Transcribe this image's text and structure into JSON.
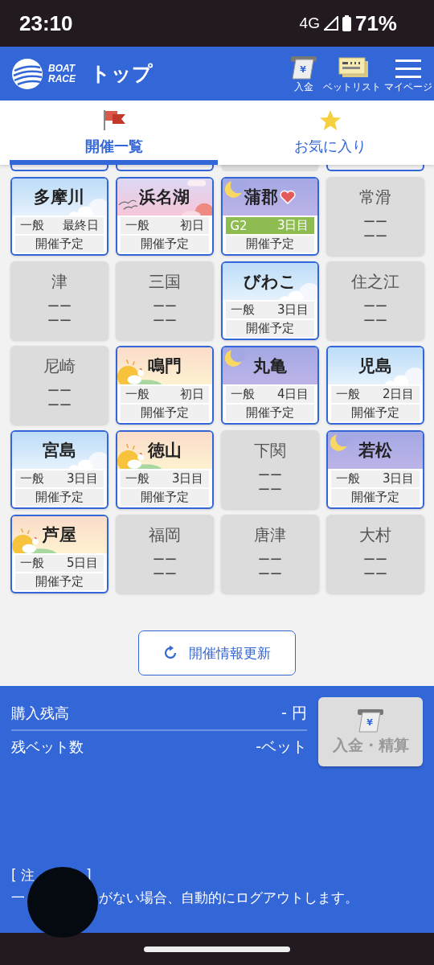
{
  "status_bar": {
    "time": "23:10",
    "network": "4G",
    "battery": "71%"
  },
  "header": {
    "logo_lines": [
      "BOAT",
      "RACE"
    ],
    "title": "トップ",
    "actions": [
      {
        "kind": "deposit",
        "label": "入金",
        "glyph": "¥"
      },
      {
        "kind": "betlist",
        "label": "ベットリスト"
      },
      {
        "kind": "menu",
        "label": "マイページ"
      }
    ]
  },
  "tabs": [
    {
      "kind": "flag",
      "label": "開催一覧",
      "selected": true
    },
    {
      "kind": "star",
      "label": "お気に入り",
      "selected": false
    }
  ],
  "peek_row": [
    {
      "active": true
    },
    {
      "active": true
    },
    {
      "active": false
    },
    {
      "active": true
    }
  ],
  "venues": [
    {
      "name": "多摩川",
      "active": true,
      "kind": "day",
      "favorite": false,
      "grade": "一般",
      "day": "最終日",
      "highlight": false,
      "status": "開催予定"
    },
    {
      "name": "浜名湖",
      "active": true,
      "kind": "dusk",
      "favorite": false,
      "grade": "一般",
      "day": "初日",
      "highlight": false,
      "status": "開催予定"
    },
    {
      "name": "蒲郡",
      "active": true,
      "kind": "night",
      "favorite": true,
      "grade": "G2",
      "day": "3日目",
      "highlight": true,
      "status": "開催予定"
    },
    {
      "name": "常滑",
      "active": false,
      "lines": [
        "ーー",
        "ーー"
      ]
    },
    {
      "name": "津",
      "active": false,
      "lines": [
        "ーー",
        "ーー"
      ]
    },
    {
      "name": "三国",
      "active": false,
      "lines": [
        "ーー",
        "ーー"
      ]
    },
    {
      "name": "びわこ",
      "active": true,
      "kind": "day",
      "favorite": false,
      "grade": "一般",
      "day": "3日目",
      "highlight": false,
      "status": "開催予定"
    },
    {
      "name": "住之江",
      "active": false,
      "lines": [
        "ーー",
        "ーー"
      ]
    },
    {
      "name": "尼崎",
      "active": false,
      "lines": [
        "ーー",
        "ーー"
      ]
    },
    {
      "name": "鳴門",
      "active": true,
      "kind": "morning",
      "favorite": false,
      "grade": "一般",
      "day": "初日",
      "highlight": false,
      "status": "開催予定"
    },
    {
      "name": "丸亀",
      "active": true,
      "kind": "night",
      "favorite": false,
      "grade": "一般",
      "day": "4日目",
      "highlight": false,
      "status": "開催予定"
    },
    {
      "name": "児島",
      "active": true,
      "kind": "day",
      "favorite": false,
      "grade": "一般",
      "day": "2日目",
      "highlight": false,
      "status": "開催予定"
    },
    {
      "name": "宮島",
      "active": true,
      "kind": "day",
      "favorite": false,
      "grade": "一般",
      "day": "3日目",
      "highlight": false,
      "status": "開催予定"
    },
    {
      "name": "徳山",
      "active": true,
      "kind": "morning",
      "favorite": false,
      "grade": "一般",
      "day": "3日目",
      "highlight": false,
      "status": "開催予定"
    },
    {
      "name": "下関",
      "active": false,
      "lines": [
        "ーー",
        "ーー"
      ]
    },
    {
      "name": "若松",
      "active": true,
      "kind": "night",
      "favorite": false,
      "grade": "一般",
      "day": "3日目",
      "highlight": false,
      "status": "開催予定"
    },
    {
      "name": "芦屋",
      "active": true,
      "kind": "morning",
      "favorite": false,
      "grade": "一般",
      "day": "5日目",
      "highlight": false,
      "status": "開催予定"
    },
    {
      "name": "福岡",
      "active": false,
      "lines": [
        "ーー",
        "ーー"
      ]
    },
    {
      "name": "唐津",
      "active": false,
      "lines": [
        "ーー",
        "ーー"
      ]
    },
    {
      "name": "大村",
      "active": false,
      "lines": [
        "ーー",
        "ーー"
      ]
    }
  ],
  "refresh_button": "開催情報更新",
  "account": {
    "rows": [
      {
        "label": "購入残高",
        "value": "- 円"
      },
      {
        "label": "残ベット数",
        "value": "-ベット"
      }
    ],
    "button": {
      "label": "入金・精算",
      "glyph": "¥",
      "disabled": true
    }
  },
  "notice": {
    "heading_parts": [
      "[ 注",
      "]"
    ],
    "text_parts": [
      "一",
      "がない場合、自動的にログアウトします。"
    ]
  }
}
